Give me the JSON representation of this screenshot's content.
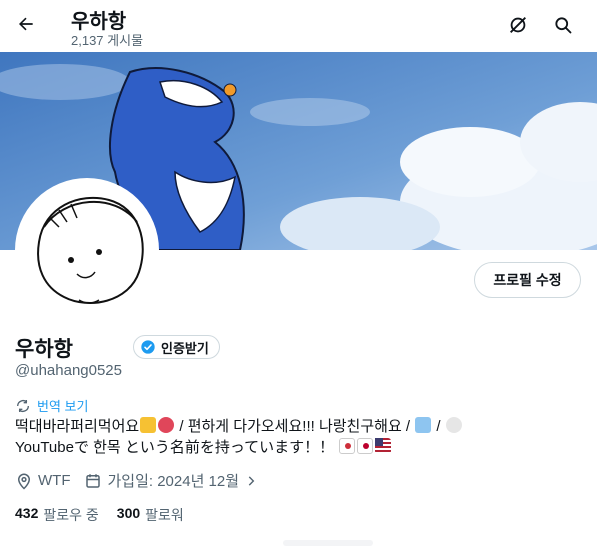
{
  "header": {
    "title": "우하항",
    "post_count": "2,137 게시물",
    "back_icon": "arrow-left-icon",
    "grok_icon": "grok-slash-icon",
    "search_icon": "search-icon"
  },
  "profile": {
    "name": "우하항",
    "verify_label": "인증받기",
    "handle": "@uhahang0525",
    "edit_label": "프로필 수정",
    "translate_label": "번역 보기",
    "bio_line1_a": "떡대바라퍼리먹어요",
    "bio_line1_b": " / 편하게 다가오세요!!! 나랑친구해요 / ",
    "bio_line1_c": " / ",
    "bio_line2": "YouTubeで 한목 という名前を持っています！！",
    "location": "WTF",
    "joined": "가입일: 2024년 12월"
  },
  "stats": {
    "following_count": "432",
    "following_label": "팔로우 중",
    "followers_count": "300",
    "followers_label": "팔로워"
  },
  "colors": {
    "accent": "#1d9bf0",
    "muted": "#536471",
    "text": "#0f1419",
    "banner_sky": "#4f86c7"
  }
}
